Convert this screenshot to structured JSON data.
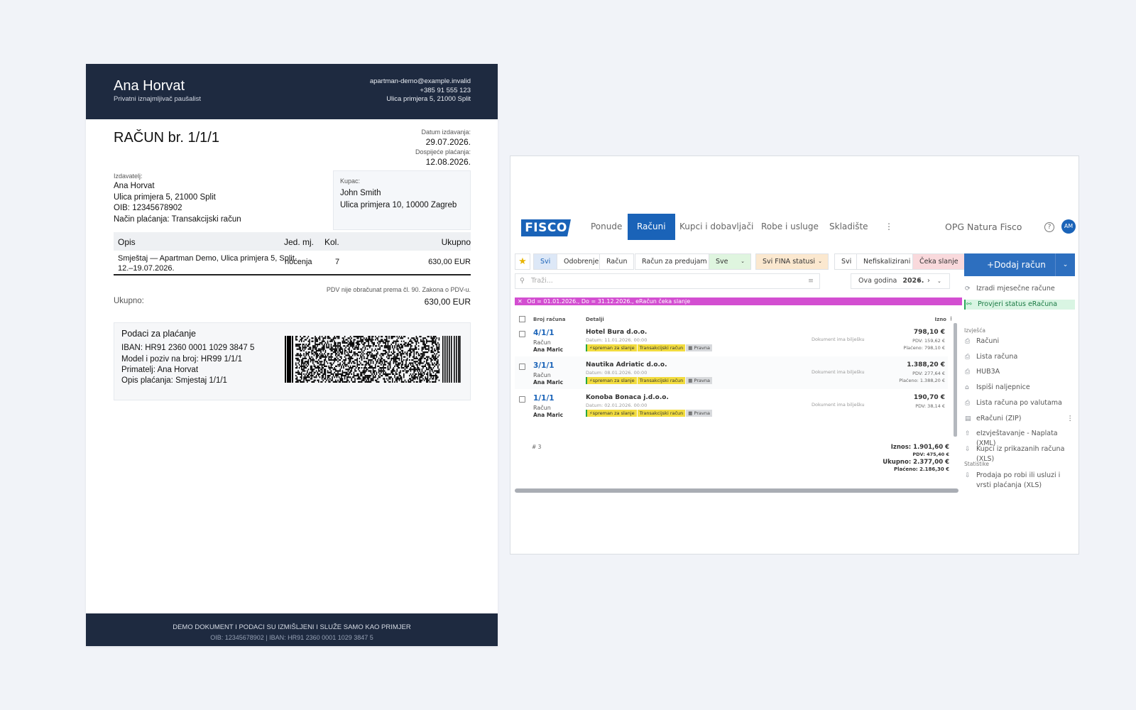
{
  "invoice": {
    "seller_name": "Ana Horvat",
    "seller_subtitle": "Privatni iznajmljivač paušalist",
    "contact": [
      "apartman-demo@example.invalid",
      "+385 91 555 123",
      "Ulica primjera 5, 21000 Split"
    ],
    "title": "RAČUN br. 1/1/1",
    "issue_label": "Datum izdavanja:",
    "issue_date": "29.07.2026.",
    "due_label": "Dospijeće plaćanja:",
    "due_date": "12.08.2026.",
    "issuer_label": "Izdavatelj:",
    "issuer_lines": [
      "Ana Horvat",
      "Ulica primjera 5, 21000 Split",
      "OIB: 12345678902",
      "Način plaćanja: Transakcijski račun"
    ],
    "buyer_label": "Kupac:",
    "buyer_lines": [
      "John Smith",
      "Ulica primjera 10, 10000 Zagreb"
    ],
    "columns": {
      "desc": "Opis",
      "unit": "Jed. mj.",
      "qty": "Kol.",
      "total": "Ukupno"
    },
    "item": {
      "desc_1": "Smještaj — Apartman Demo, Ulica primjera 5, Split",
      "desc_2": "12.–19.07.2026.",
      "unit": "noćenja",
      "qty": "7",
      "total": "630,00 EUR"
    },
    "vat_note": "PDV nije obračunat prema čl. 90. Zakona o PDV-u.",
    "total_label": "Ukupno:",
    "total_value": "630,00 EUR",
    "payment_title": "Podaci za plaćanje",
    "payment_lines": [
      "IBAN: HR91 2360 0001 1029 3847 5",
      "Model i poziv na broj: HR99 1/1/1",
      "Primatelj: Ana Horvat",
      "Opis plaćanja: Smjestaj 1/1/1"
    ],
    "footer_1": "DEMO DOKUMENT I PODACI SU IZMIŠLJENI I SLUŽE SAMO KAO PRIMJER",
    "footer_2": "OIB: 12345678902 | IBAN: HR91 2360 0001 1029 3847 5"
  },
  "app": {
    "logo": "FISCO",
    "nav": [
      "Ponude",
      "Računi",
      "Kupci i dobavljači",
      "Robe i usluge",
      "Skladište",
      "⋮"
    ],
    "org": "OPG Natura Fisco",
    "avatar": "AM",
    "help": "?",
    "filters": {
      "type": [
        "Svi",
        "Odobrenje",
        "Račun",
        "Račun za predujam"
      ],
      "status": "Sve",
      "fina": "Svi FINA statusi",
      "fisc": [
        "Svi",
        "Nefiskalizirani",
        "Čeka slanje"
      ]
    },
    "add_button": "Dodaj račun",
    "search_placeholder": "Traži...",
    "period_label": "Ova godina",
    "period_year": "2026.",
    "active_filter": "Od = 01.01.2026., Do = 31.12.2026., eRačun čeka slanje",
    "table_headers": {
      "number": "Broj računa",
      "details": "Detalji",
      "amount": "Izno"
    },
    "rows": [
      {
        "number": "4/1/1",
        "kind": "Račun",
        "person": "Ana Maric",
        "client": "Hotel Bura d.o.o.",
        "date": "Datum: 11.01.2026. 00:00",
        "tags": [
          "spreman za slanje",
          "Transakcijski račun",
          "Pravna"
        ],
        "note": "Dokument ima bilješku",
        "amount": "798,10 €",
        "pdv": "PDV: 159,62 €",
        "paid": "Plaćeno: 798,10 €"
      },
      {
        "number": "3/1/1",
        "kind": "Račun",
        "person": "Ana Maric",
        "client": "Nautika Adriatic d.o.o.",
        "date": "Datum: 08.01.2026. 00:00",
        "tags": [
          "spreman za slanje",
          "Transakcijski račun",
          "Pravna"
        ],
        "note": "Dokument ima bilješku",
        "amount": "1.388,20 €",
        "pdv": "PDV: 277,64 €",
        "paid": "Plaćeno: 1.388,20 €"
      },
      {
        "number": "1/1/1",
        "kind": "Račun",
        "person": "Ana Maric",
        "client": "Konoba Bonaca j.d.o.o.",
        "date": "Datum: 02.01.2026. 00:00",
        "tags": [
          "spreman za slanje",
          "Transakcijski račun",
          "Pravna"
        ],
        "note": "Dokument ima bilješku",
        "amount": "190,70 €",
        "pdv": "PDV: 38,14 €",
        "paid": ""
      }
    ],
    "count": "# 3",
    "totals": {
      "iznos": "Iznos: 1.901,60 €",
      "pdv": "PDV: 475,40 €",
      "ukupno": "Ukupno: 2.377,00 €",
      "placeno": "Plaćeno: 2.186,30 €"
    },
    "side": {
      "actions": [
        "Izradi mjesečne račune",
        "Provjeri status eRačuna"
      ],
      "reports_head": "Izvješća",
      "reports": [
        "Računi",
        "Lista računa",
        "HUB3A",
        "Ispiši naljepnice",
        "Lista računa po valutama",
        "eRačuni (ZIP)",
        "eIzvještavanje - Naplata (XML)",
        "Kupci iz prikazanih računa (XLS)"
      ],
      "stats_head": "Statistike",
      "stats": [
        "Prodaja po robi ili usluzi i vrsti plaćanja (XLS)"
      ]
    }
  }
}
